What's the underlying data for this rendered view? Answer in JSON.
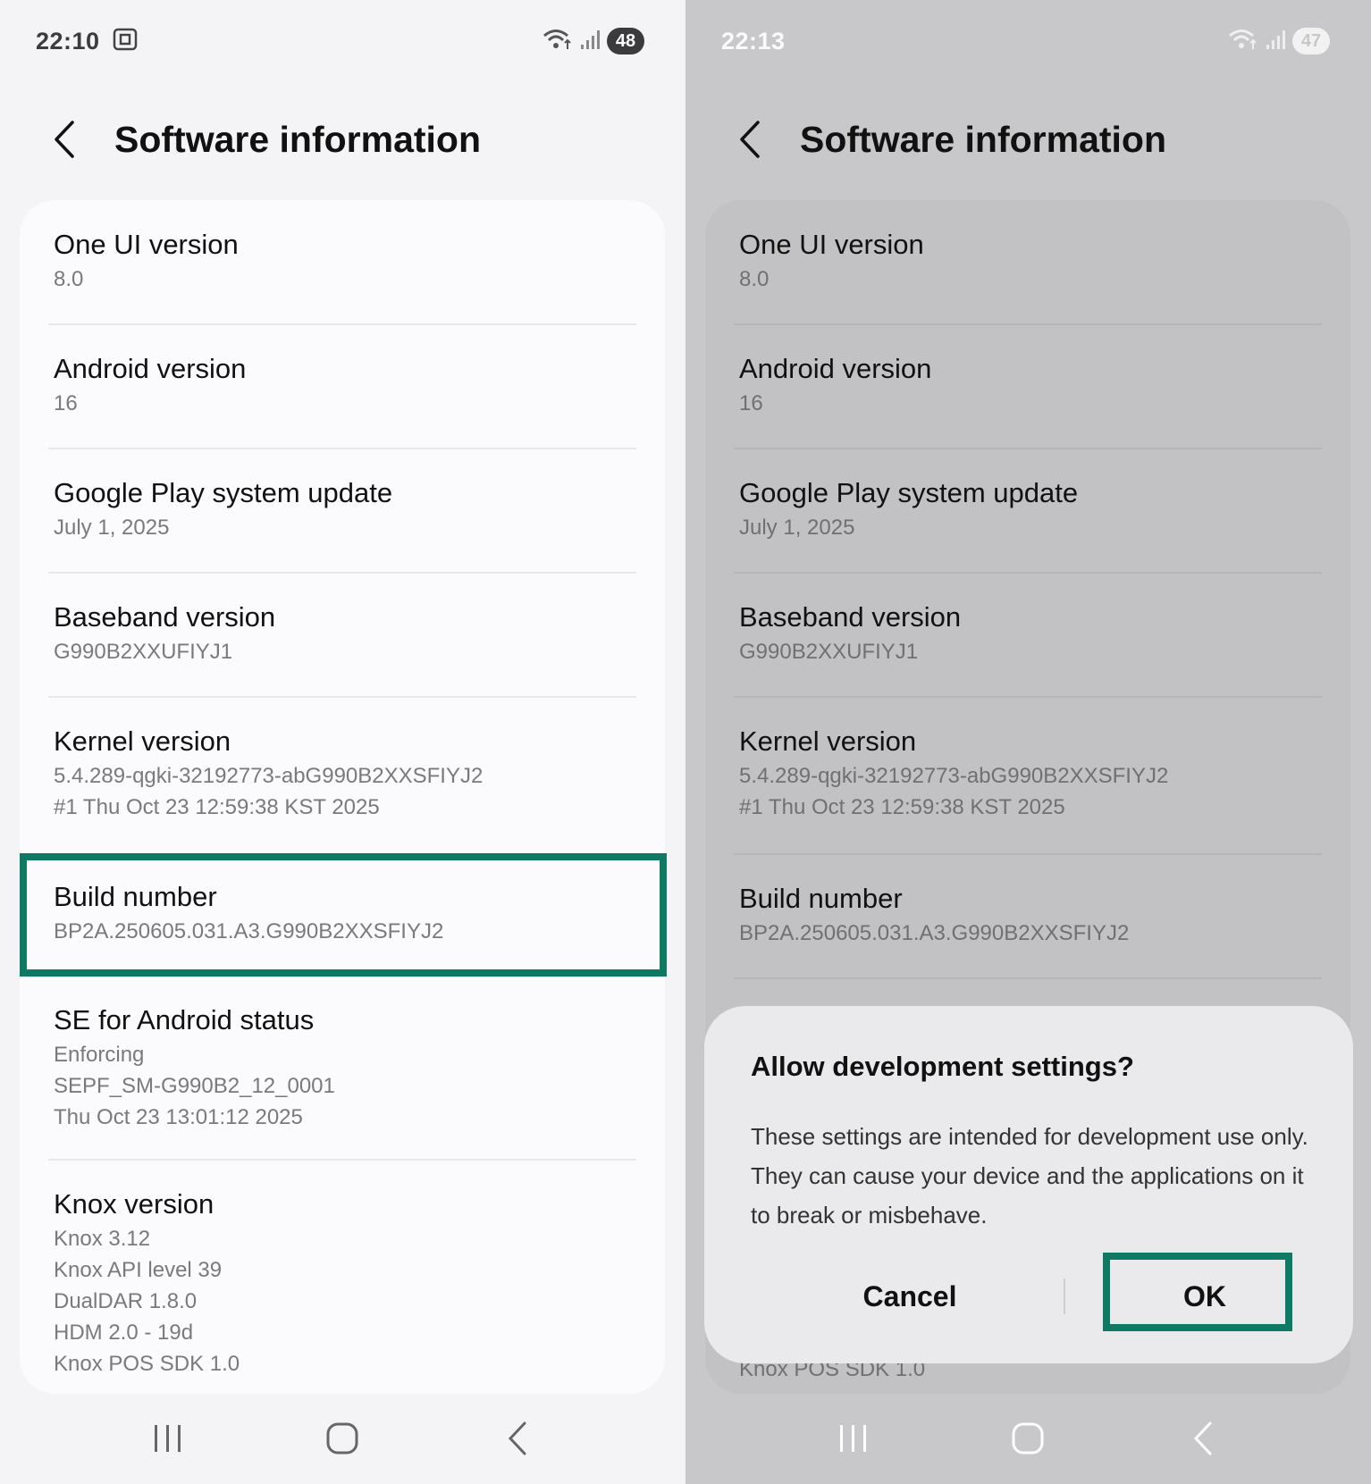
{
  "left": {
    "status": {
      "time": "22:10",
      "battery": "48"
    },
    "title": "Software information",
    "items": [
      {
        "label": "One UI version",
        "sub": [
          "8.0"
        ]
      },
      {
        "label": "Android version",
        "sub": [
          "16"
        ]
      },
      {
        "label": "Google Play system update",
        "sub": [
          "July 1, 2025"
        ]
      },
      {
        "label": "Baseband version",
        "sub": [
          "G990B2XXUFIYJ1"
        ]
      },
      {
        "label": "Kernel version",
        "sub": [
          "5.4.289-qgki-32192773-abG990B2XXSFIYJ2",
          "#1 Thu Oct 23 12:59:38 KST 2025"
        ]
      },
      {
        "label": "Build number",
        "sub": [
          "BP2A.250605.031.A3.G990B2XXSFIYJ2"
        ]
      },
      {
        "label": "SE for Android status",
        "sub": [
          "Enforcing",
          "SEPF_SM-G990B2_12_0001",
          "Thu Oct 23 13:01:12 2025"
        ]
      },
      {
        "label": "Knox version",
        "sub": [
          "Knox 3.12",
          "Knox API level 39",
          "DualDAR 1.8.0",
          "HDM 2.0 - 19d",
          "Knox POS SDK 1.0"
        ]
      }
    ]
  },
  "right": {
    "status": {
      "time": "22:13",
      "battery": "47"
    },
    "title": "Software information",
    "items": [
      {
        "label": "One UI version",
        "sub": [
          "8.0"
        ]
      },
      {
        "label": "Android version",
        "sub": [
          "16"
        ]
      },
      {
        "label": "Google Play system update",
        "sub": [
          "July 1, 2025"
        ]
      },
      {
        "label": "Baseband version",
        "sub": [
          "G990B2XXUFIYJ1"
        ]
      },
      {
        "label": "Kernel version",
        "sub": [
          "5.4.289-qgki-32192773-abG990B2XXSFIYJ2",
          "#1 Thu Oct 23 12:59:38 KST 2025"
        ]
      },
      {
        "label": "Build number",
        "sub": [
          "BP2A.250605.031.A3.G990B2XXSFIYJ2"
        ]
      },
      {
        "label": "",
        "sub": [
          "Knox POS SDK 1.0"
        ]
      }
    ],
    "dialog": {
      "title": "Allow development settings?",
      "body": "These settings are intended for development use only. They can cause your device and the applications on it to break or misbehave.",
      "cancel": "Cancel",
      "ok": "OK"
    }
  },
  "colors": {
    "highlight": "#0e7a64"
  }
}
